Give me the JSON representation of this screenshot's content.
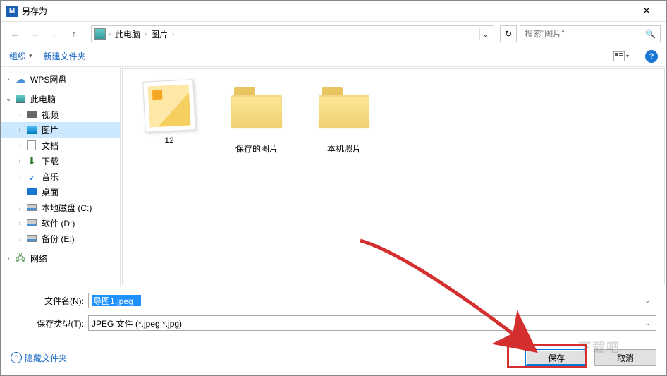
{
  "titlebar": {
    "title": "另存为"
  },
  "nav": {
    "breadcrumbs": [
      "此电脑",
      "图片"
    ],
    "search_placeholder": "搜索\"图片\""
  },
  "toolbar": {
    "organize": "组织",
    "new_folder": "新建文件夹"
  },
  "sidebar": {
    "items": [
      {
        "label": "WPS网盘",
        "icon": "cloud",
        "depth": 0,
        "expand": "closed"
      },
      {
        "gap": true
      },
      {
        "label": "此电脑",
        "icon": "pc",
        "depth": 0,
        "expand": "open"
      },
      {
        "label": "视频",
        "icon": "video",
        "depth": 1,
        "expand": "closed"
      },
      {
        "label": "图片",
        "icon": "pic",
        "depth": 1,
        "expand": "closed",
        "selected": true
      },
      {
        "label": "文档",
        "icon": "doc",
        "depth": 1,
        "expand": "closed"
      },
      {
        "label": "下载",
        "icon": "down",
        "depth": 1,
        "expand": "closed"
      },
      {
        "label": "音乐",
        "icon": "music",
        "depth": 1,
        "expand": "closed"
      },
      {
        "label": "桌面",
        "icon": "desk",
        "depth": 1,
        "expand": "none"
      },
      {
        "label": "本地磁盘 (C:)",
        "icon": "disk",
        "depth": 1,
        "expand": "closed"
      },
      {
        "label": "软件 (D:)",
        "icon": "disk",
        "depth": 1,
        "expand": "closed"
      },
      {
        "label": "备份 (E:)",
        "icon": "disk",
        "depth": 1,
        "expand": "closed"
      },
      {
        "gap": true
      },
      {
        "label": "网络",
        "icon": "net",
        "depth": 0,
        "expand": "closed"
      }
    ]
  },
  "content": {
    "items": [
      {
        "name": "12",
        "type": "image"
      },
      {
        "name": "保存的图片",
        "type": "folder"
      },
      {
        "name": "本机照片",
        "type": "folder"
      }
    ]
  },
  "fields": {
    "filename_label": "文件名(N):",
    "filename_value": "导图1.jpeg",
    "filetype_label": "保存类型(T):",
    "filetype_value": "JPEG 文件 (*.jpeg;*.jpg)"
  },
  "footer": {
    "hide_folders": "隐藏文件夹",
    "save": "保存",
    "cancel": "取消"
  },
  "watermark": "下载吧"
}
